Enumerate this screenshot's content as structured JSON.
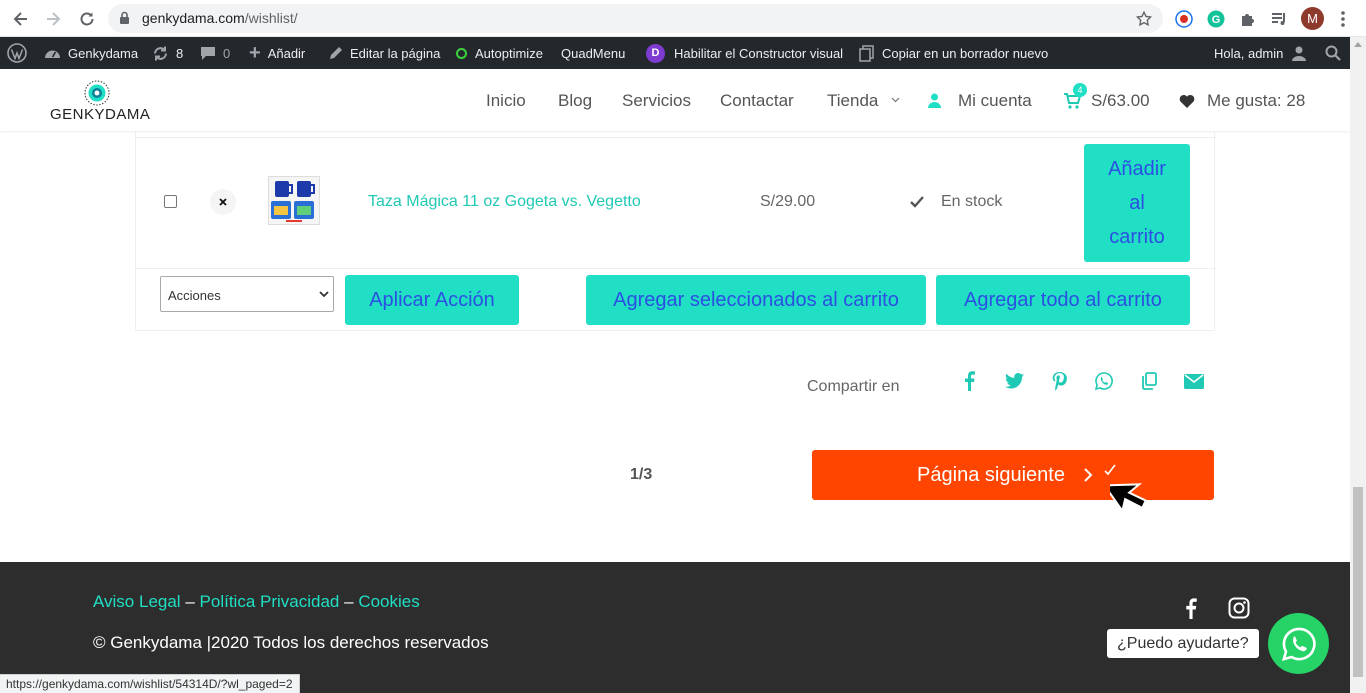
{
  "browser": {
    "url_domain": "genkydama.com",
    "url_path": "/wishlist/",
    "profile_initial": "M"
  },
  "adminbar": {
    "site_name": "Genkydama",
    "updates_count": "8",
    "comments_count": "0",
    "add_label": "Añadir",
    "edit_label": "Editar la página",
    "autoptimize_label": "Autoptimize",
    "quadmenu_label": "QuadMenu",
    "builder_label": "Habilitar el Constructor visual",
    "builder_badge": "D",
    "copy_label": "Copiar en un borrador nuevo",
    "greeting": "Hola, admin"
  },
  "header": {
    "logo_text": "GENKYDAMA",
    "menu": [
      {
        "label": "Inicio"
      },
      {
        "label": "Blog"
      },
      {
        "label": "Servicios"
      },
      {
        "label": "Contactar"
      },
      {
        "label": "Tienda"
      },
      {
        "label": "Mi cuenta"
      }
    ],
    "cart_badge": "4",
    "cart_total": "S/63.00",
    "likes_label": "Me gusta: 28"
  },
  "wishlist": {
    "item": {
      "name": "Taza Mágica 11 oz Gogeta vs. Vegetto",
      "price": "S/29.00",
      "stock": "En stock",
      "add_to_cart_label": "Añadir al carrito"
    },
    "actions_select": "Acciones",
    "apply_label": "Aplicar Acción",
    "add_selected_label": "Agregar seleccionados al carrito",
    "add_all_label": "Agregar todo al carrito"
  },
  "share": {
    "label": "Compartir en",
    "icons": [
      "facebook-icon",
      "twitter-icon",
      "pinterest-icon",
      "whatsapp-icon",
      "copy-icon",
      "email-icon"
    ]
  },
  "pagination": {
    "page": "1/3",
    "next_label": "Página siguiente"
  },
  "footer": {
    "link_legal": "Aviso Legal",
    "link_privacy": "Política Privacidad",
    "link_cookies": "Cookies",
    "separator": "–",
    "copyright": "© Genkydama |2020 Todos los derechos reservados",
    "help_label": "¿Puedo ayudarte?"
  },
  "status_url": "https://genkydama.com/wishlist/54314D/?wl_paged=2",
  "colors": {
    "teal": "#20dfc4",
    "orange": "#ff4500",
    "whatsapp": "#25d366"
  }
}
